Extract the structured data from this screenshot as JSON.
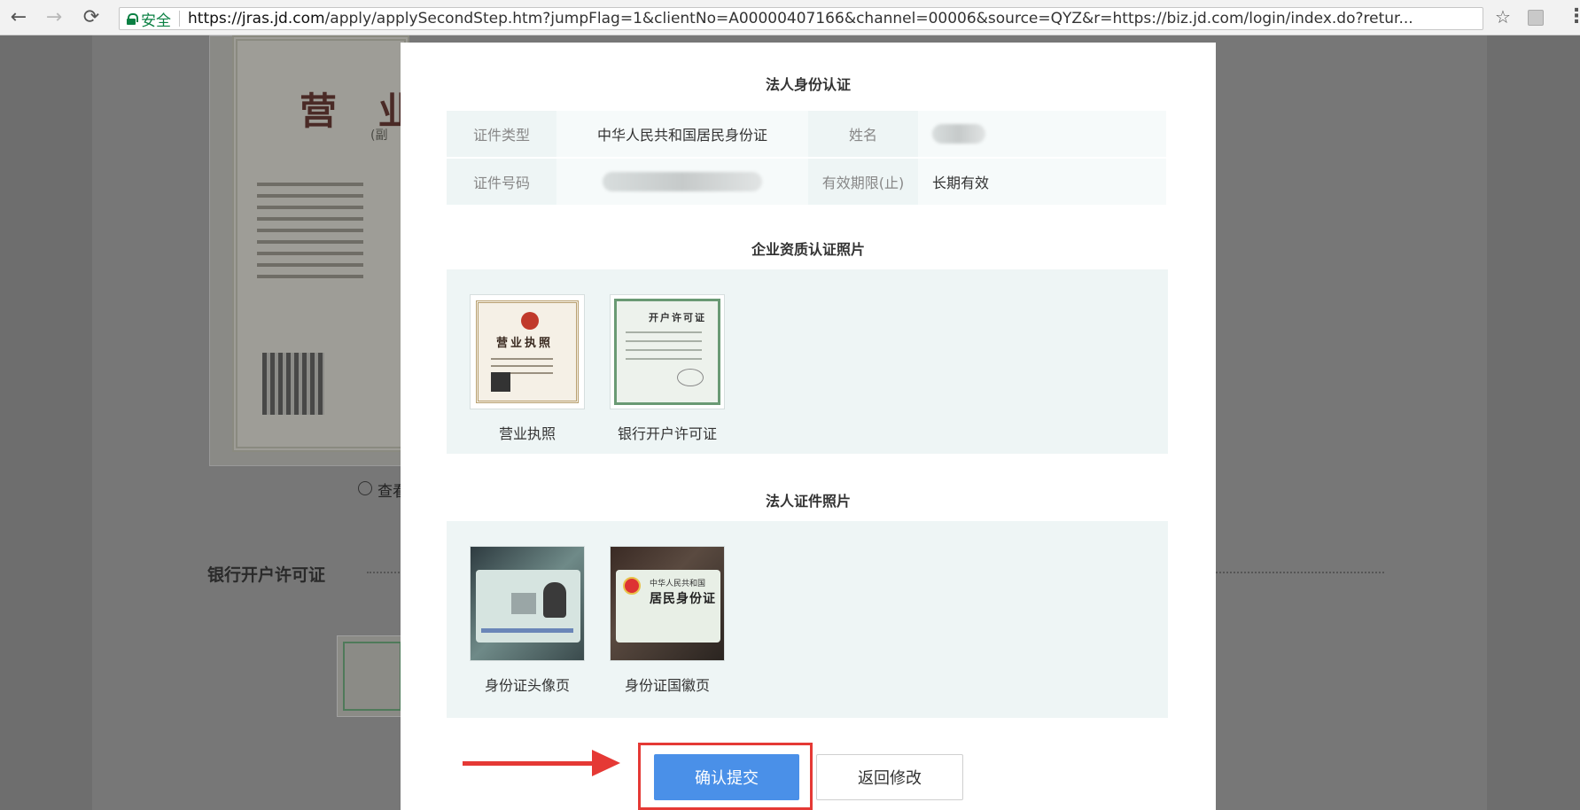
{
  "browser": {
    "secure_label": "安全",
    "url_host": "https://jras.jd.com",
    "url_path": "/apply/applySecondStep.htm?jumpFlag=1&clientNo=A00000407166&channel=00006&source=QYZ&r=https://biz.jd.com/login/index.do?retur..."
  },
  "background_page": {
    "license_title": "营 业",
    "license_subtitle": "(副",
    "preview_link": "查看",
    "bank_section_title": "银行开户许可证"
  },
  "modal": {
    "legal_identity_title": "法人身份认证",
    "identity_table": {
      "rows": [
        {
          "label1": "证件类型",
          "value1": "中华人民共和国居民身份证",
          "label2": "姓名",
          "value2": ""
        },
        {
          "label1": "证件号码",
          "value1": "",
          "label2": "有效期限(止)",
          "value2": "长期有效"
        }
      ]
    },
    "enterprise_photos_title": "企业资质认证照片",
    "enterprise_photos": [
      {
        "caption": "营业执照",
        "doc_text": "营业执照"
      },
      {
        "caption": "银行开户许可证",
        "doc_text": "开户许可证"
      }
    ],
    "legal_photos_title": "法人证件照片",
    "legal_photos": [
      {
        "caption": "身份证头像页"
      },
      {
        "caption": "身份证国徽页",
        "doc_line1": "中华人民共和国",
        "doc_line2": "居民身份证"
      }
    ],
    "confirm_button": "确认提交",
    "back_button": "返回修改"
  },
  "colors": {
    "primary": "#4a90e8",
    "annotation_red": "#e53935",
    "panel_bg": "#eef5f5"
  }
}
